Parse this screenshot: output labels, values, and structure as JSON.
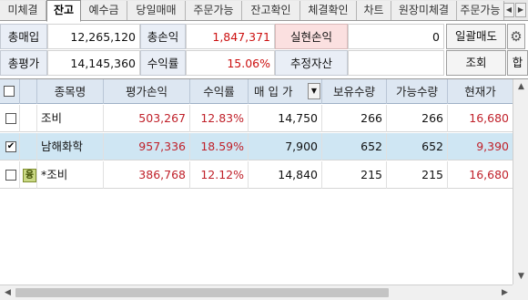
{
  "tabs": [
    {
      "label": "미체결"
    },
    {
      "label": "잔고"
    },
    {
      "label": "예수금"
    },
    {
      "label": "당일매매"
    },
    {
      "label": "주문가능"
    },
    {
      "label": "잔고확인"
    },
    {
      "label": "체결확인"
    },
    {
      "label": "차트"
    },
    {
      "label": "원장미체결"
    },
    {
      "label": "주문가능"
    }
  ],
  "summary": {
    "total_buy_label": "총매입",
    "total_buy_value": "12,265,120",
    "total_pl_label": "총손익",
    "total_pl_value": "1,847,371",
    "realized_pl_label": "실현손익",
    "realized_pl_value": "0",
    "bulk_sell_label": "일괄매도",
    "total_eval_label": "총평가",
    "total_eval_value": "14,145,360",
    "return_label": "수익률",
    "return_value": "15.06%",
    "est_asset_label": "추정자산",
    "est_asset_value": "",
    "query_label": "조회",
    "sum_label": "합"
  },
  "grid": {
    "headers": [
      "종목명",
      "평가손익",
      "수익률",
      "매 입 가",
      "보유수량",
      "가능수량",
      "현재가"
    ],
    "rows": [
      {
        "checked": false,
        "badge": "",
        "name": "조비",
        "pl": "503,267",
        "rate": "12.83%",
        "buy_price": "14,750",
        "hold_qty": "266",
        "avail_qty": "266",
        "price": "16,680"
      },
      {
        "checked": true,
        "badge": "",
        "name": "남해화학",
        "pl": "957,336",
        "rate": "18.59%",
        "buy_price": "7,900",
        "hold_qty": "652",
        "avail_qty": "652",
        "price": "9,390"
      },
      {
        "checked": false,
        "badge": "융",
        "name": "*조비",
        "pl": "386,768",
        "rate": "12.12%",
        "buy_price": "14,840",
        "hold_qty": "215",
        "avail_qty": "215",
        "price": "16,680"
      }
    ]
  },
  "icons": {
    "gear": "gear-icon",
    "sort": "sort-dropdown-icon",
    "tab_left": "chevron-left-icon",
    "tab_right": "chevron-right-icon"
  },
  "colors": {
    "profit_red": "#c0212a",
    "selected_row": "#cfe6f3",
    "header_blue": "#dde7f2",
    "realized_pink": "#fbe0e0"
  }
}
